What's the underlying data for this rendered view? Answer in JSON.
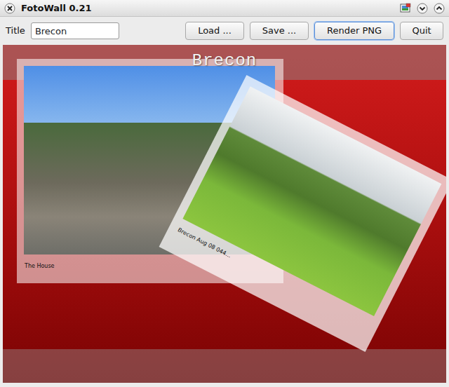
{
  "window": {
    "title": "FotoWall 0.21"
  },
  "toolbar": {
    "title_label": "Title",
    "title_value": "Brecon",
    "buttons": [
      {
        "label": "Load ...",
        "selected": false
      },
      {
        "label": "Save ...",
        "selected": false
      },
      {
        "label": "Render PNG",
        "selected": true
      },
      {
        "label": "Quit",
        "selected": false
      }
    ]
  },
  "canvas": {
    "title": "Brecon",
    "pictures": [
      {
        "caption": "The House"
      },
      {
        "caption": "Brecon Aug 08 044..."
      }
    ]
  }
}
